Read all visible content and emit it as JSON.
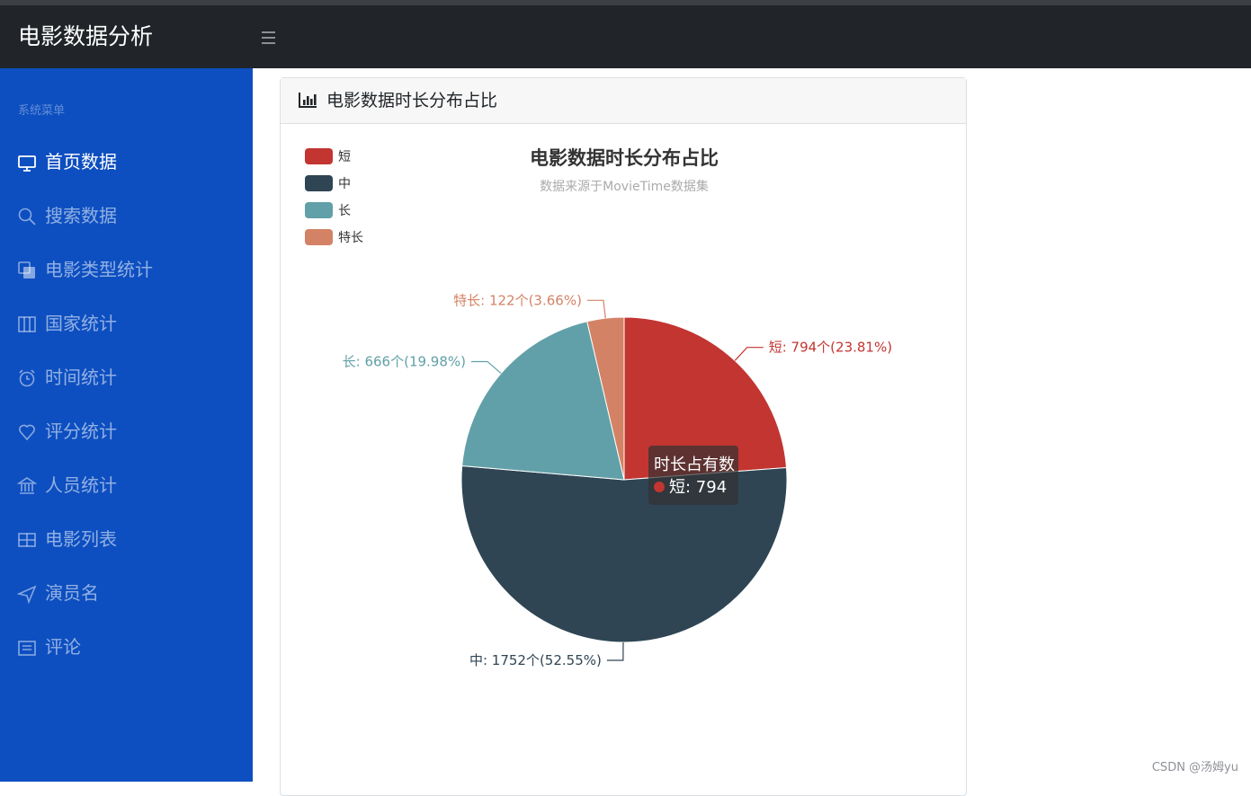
{
  "app": {
    "title": "电影数据分析"
  },
  "sidebar": {
    "heading": "系统菜单",
    "items": [
      {
        "label": "首页数据",
        "icon": "monitor-icon",
        "active": true
      },
      {
        "label": "搜索数据",
        "icon": "search-icon",
        "active": false
      },
      {
        "label": "电影类型统计",
        "icon": "copy-icon",
        "active": false
      },
      {
        "label": "国家统计",
        "icon": "columns-icon",
        "active": false
      },
      {
        "label": "时间统计",
        "icon": "alarm-clock-icon",
        "active": false
      },
      {
        "label": "评分统计",
        "icon": "heart-icon",
        "active": false
      },
      {
        "label": "人员统计",
        "icon": "bank-icon",
        "active": false
      },
      {
        "label": "电影列表",
        "icon": "table-icon",
        "active": false
      },
      {
        "label": "演员名",
        "icon": "send-icon",
        "active": false
      },
      {
        "label": "评论",
        "icon": "list-icon",
        "active": false
      }
    ]
  },
  "card": {
    "title": "电影数据时长分布占比",
    "icon": "bar-chart-icon"
  },
  "chart_data": {
    "type": "pie",
    "title": "电影数据时长分布占比",
    "subtitle": "数据来源于MovieTime数据集",
    "legend_position": "top-left",
    "series_name": "时长占有数",
    "slices": [
      {
        "name": "短",
        "value": 794,
        "percent": "23.81%",
        "label": "短: 794个(23.81%)",
        "color": "#c23531"
      },
      {
        "name": "中",
        "value": 1752,
        "percent": "52.55%",
        "label": "中: 1752个(52.55%)",
        "color": "#2f4554"
      },
      {
        "name": "长",
        "value": 666,
        "percent": "19.98%",
        "label": "长: 666个(19.98%)",
        "color": "#61a0a8"
      },
      {
        "name": "特长",
        "value": 122,
        "percent": "3.66%",
        "label": "特长: 122个(3.66%)",
        "color": "#d48265"
      }
    ],
    "tooltip": {
      "title": "时长占有数",
      "text": "短: 794"
    }
  },
  "colors": {
    "sidebar_bg": "#0d4fc0",
    "navbar_bg": "#212529"
  },
  "watermark": "CSDN @汤姆yu"
}
